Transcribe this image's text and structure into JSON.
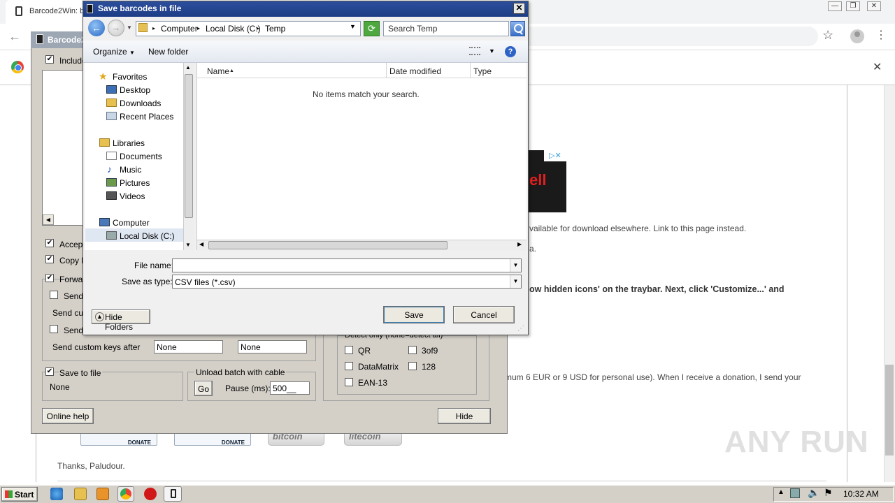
{
  "browser": {
    "tab_title": "Barcode2Win: b",
    "window_controls": [
      "minimize",
      "restore",
      "close"
    ]
  },
  "webpage": {
    "text_download": "vailable for download elsewhere. Link to this page instead.",
    "text_a": "a.",
    "text_tray": "ow hidden icons' on the traybar. Next, click 'Customize...' and",
    "text_donation": "mum 6 EUR or 9 USD for personal use). When I receive a donation, I send your",
    "ad_text": "ell",
    "ad_icons": "▷✕",
    "donate_badges": [
      "DONATE",
      "DONATE"
    ],
    "crypto_badges": [
      "bitcoin",
      "litecoin"
    ],
    "thanks": "Thanks, Paludour.",
    "watermark": "ANY RUN"
  },
  "app": {
    "title": "Barcode2",
    "include_label": "Include",
    "accept_label": "Accep",
    "copy_label": "Copy b",
    "forward_label": "Forwar",
    "send1_label": "Send",
    "send_custom_label": "Send cu",
    "send2_label": "Send",
    "send_custom_after_label": "Send custom keys after",
    "custom_key_1": "None",
    "custom_key_2": "None",
    "save_to_file_label": "Save to file",
    "save_to_file_value": "None",
    "unload_batch_label": "Unload batch with cable",
    "go_label": "Go",
    "pause_label": "Pause (ms):",
    "pause_value": "500__",
    "detect_label": "Detect only (none=detect all)",
    "barcode_types": [
      "QR",
      "3of9",
      "DataMatrix",
      "128",
      "EAN-13"
    ],
    "online_help": "Online help",
    "hide": "Hide"
  },
  "dialog": {
    "title": "Save barcodes in file",
    "breadcrumbs": [
      "Computer",
      "Local Disk (C:)",
      "Temp"
    ],
    "search_placeholder": "Search Temp",
    "organize": "Organize",
    "new_folder": "New folder",
    "nav": {
      "favorites": "Favorites",
      "desktop": "Desktop",
      "downloads": "Downloads",
      "recent": "Recent Places",
      "libraries": "Libraries",
      "documents": "Documents",
      "music": "Music",
      "pictures": "Pictures",
      "videos": "Videos",
      "computer": "Computer",
      "local_disk": "Local Disk (C:)"
    },
    "columns": [
      "Name",
      "Date modified",
      "Type"
    ],
    "empty_message": "No items match your search.",
    "file_name_label": "File name:",
    "file_name_value": "",
    "save_type_label": "Save as type:",
    "save_type_value": "CSV files (*.csv)",
    "hide_folders": "Hide Folders",
    "save": "Save",
    "cancel": "Cancel"
  },
  "taskbar": {
    "start": "Start",
    "clock": "10:32 AM"
  }
}
